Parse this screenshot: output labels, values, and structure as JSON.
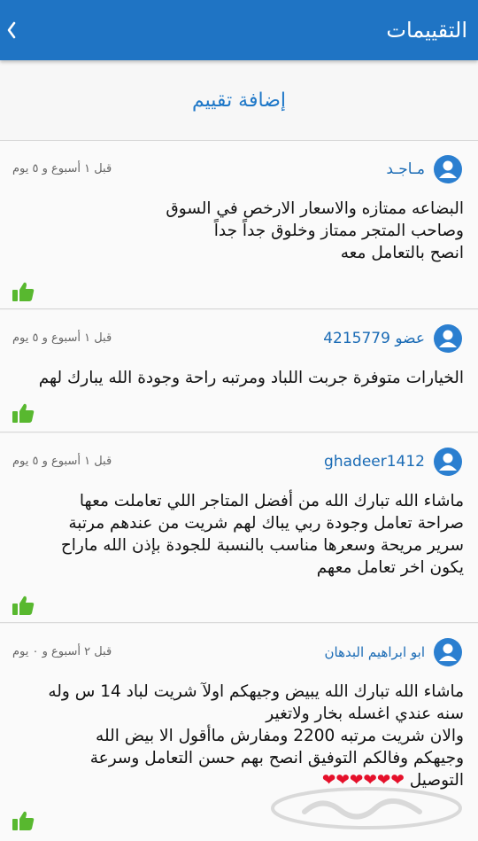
{
  "header": {
    "title": "التقييمات",
    "back_icon": "chevron-left-icon"
  },
  "add_review_label": "إضافة تقييم",
  "reviews": [
    {
      "author": "مـاجـد",
      "time": "قبل ١ أسبوع و ٥ يوم",
      "lines": [
        "البضاعه ممتازه والاسعار الارخص في السوق",
        "وصاحب المتجر ممتاز وخلوق جداً جداً",
        "انصح بالتعامل معه"
      ]
    },
    {
      "author": "عضو 4215779",
      "time": "قبل ١ أسبوع و ٥ يوم",
      "lines": [
        "الخيارات متوفرة جربت اللباد ومرتبه راحة وجودة الله يبارك لهم"
      ]
    },
    {
      "author": "ghadeer1412",
      "time": "قبل ١ أسبوع و ٥ يوم",
      "lines": [
        "ماشاء الله تبارك الله من أفضل المتاجر اللي تعاملت معها",
        "صراحة تعامل وجودة ربي يباك لهم شريت من عندهم مرتبة",
        "سرير مريحة وسعرها مناسب بالنسبة للجودة بإذن الله ماراح",
        "يكون اخر تعامل معهم"
      ]
    },
    {
      "author": "ابو ابراهيم البدهان",
      "time": "قبل ٢ أسبوع و ٠ يوم",
      "lines": [
        "ماشاء الله تبارك الله يبيض وجيهكم اولآ شريت لباد 14 س وله",
        "سنه عندي اغسله بخار ولاتغير",
        "والان شريت مرتبه 2200 ومفارش ماأقول الا بيض الله",
        "وجيهكم وفالكم التوفيق انصح بهم حسن التعامل وسرعة",
        "التوصيل"
      ],
      "hearts": "❤❤❤❤❤❤"
    }
  ],
  "watermark": "حراج",
  "colors": {
    "appbar": "#1f74c4",
    "link": "#1a6bb5",
    "like": "#58b82f",
    "heart": "#e5102a"
  }
}
